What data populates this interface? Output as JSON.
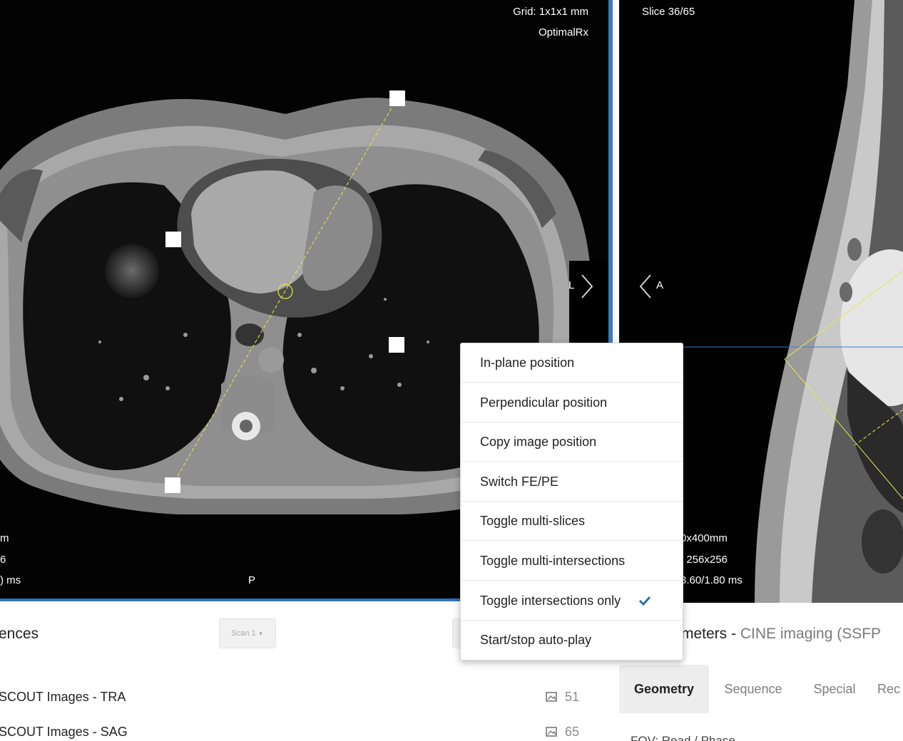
{
  "viewport_left": {
    "grid_label": "Grid: 1x1x1 mm",
    "mode_label": "OptimalRx",
    "orient_right": "L",
    "orient_bottom": "P",
    "info_lines": [
      "m",
      "6",
      ") ms"
    ]
  },
  "viewport_right": {
    "slice_label": "Slice 36/65",
    "orient_left": "A",
    "info_lines": [
      "0x400mm",
      ": 256x256",
      "3.60/1.80 ms"
    ]
  },
  "sequences": {
    "title": "ences",
    "scan_dropdown": "Scan 1",
    "items": [
      {
        "name": "SCOUT Images - TRA",
        "count": "51"
      },
      {
        "name": "SCOUT Images - SAG",
        "count": "65"
      }
    ]
  },
  "parameters": {
    "title_prefix": "meters - ",
    "title_sequence": "CINE imaging (SSFP",
    "tabs": [
      "Geometry",
      "Sequence",
      "Special",
      "Rec"
    ],
    "active_tab": "Geometry",
    "cut_row": "FOV: Read / Phase ..."
  },
  "context_menu": {
    "items": [
      {
        "label": "In-plane position",
        "checked": false
      },
      {
        "label": "Perpendicular position",
        "checked": false
      },
      {
        "label": "Copy image position",
        "checked": false
      },
      {
        "label": "Switch FE/PE",
        "checked": false
      },
      {
        "label": "Toggle multi-slices",
        "checked": false
      },
      {
        "label": "Toggle multi-intersections",
        "checked": false
      },
      {
        "label": "Toggle intersections only",
        "checked": true
      },
      {
        "label": "Start/stop auto-play",
        "checked": false
      }
    ],
    "check_color": "#2f6fae"
  },
  "colors": {
    "accent": "#3b7cc4",
    "slice_line": "#e8e84a"
  }
}
